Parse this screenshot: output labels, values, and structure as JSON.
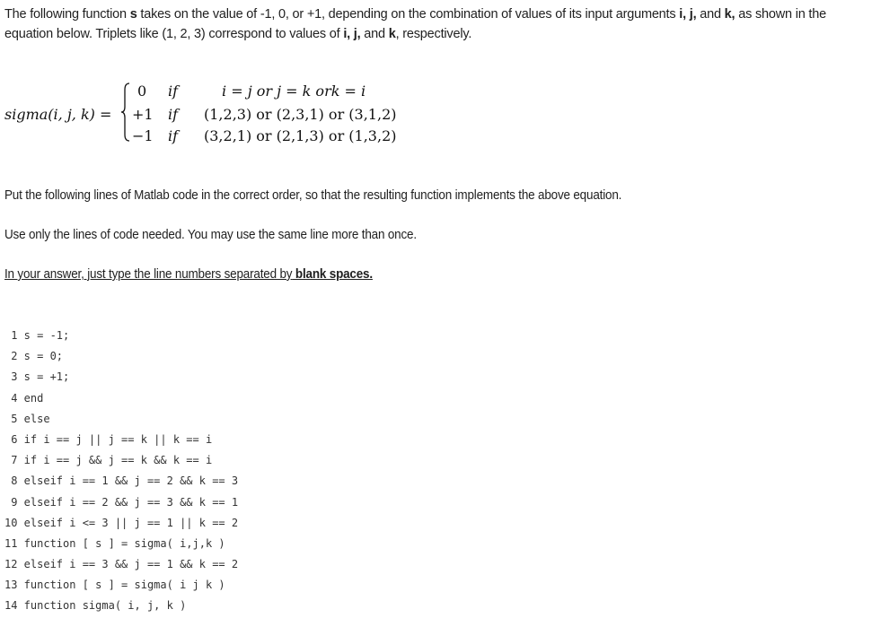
{
  "intro": {
    "part1": "The following function ",
    "s": "s",
    "part2": " takes on the value of -1, 0, or +1, depending on the combination of values of its input arguments ",
    "ijk1": "i, j,",
    "and1": " and ",
    "k1": "k,",
    "part3": " as shown in the equation below. Triplets like (1, 2, 3) correspond to values of ",
    "ijk2": "i, j,",
    "and2": " and ",
    "k2": "k",
    "part4": ", respectively."
  },
  "equation": {
    "lhs": "sigma(i, j, k) =",
    "rows": [
      {
        "value": "0",
        "if": "if",
        "condition": "i = j or j = k ork = i"
      },
      {
        "value": "+1",
        "if": "if",
        "condition": "(1,2,3) or (2,3,1) or (3,1,2)"
      },
      {
        "value": "−1",
        "if": "if",
        "condition": "(3,2,1) or (2,1,3) or (1,3,2)"
      }
    ]
  },
  "instructions": {
    "order": "Put the following lines of Matlab code in the correct order, so that the resulting function implements the above equation.",
    "use_only": "Use only the lines of code needed. You may use the same line more than once.",
    "answer_plain": "In your answer, just type the line numbers separated by",
    "answer_bold": " blank spaces."
  },
  "code_lines": [
    " 1 s = -1;",
    " 2 s = 0;",
    " 3 s = +1;",
    " 4 end",
    " 5 else",
    " 6 if i == j || j == k || k == i",
    " 7 if i == j && j == k && k == i",
    " 8 elseif i == 1 && j == 2 && k == 3",
    " 9 elseif i == 2 && j == 3 && k == 1",
    "10 elseif i <= 3 || j == 1 || k == 2",
    "11 function [ s ] = sigma( i,j,k )",
    "12 elseif i == 3 && j == 1 && k == 2",
    "13 function [ s ] = sigma( i j k )",
    "14 function sigma( i, j, k )"
  ]
}
